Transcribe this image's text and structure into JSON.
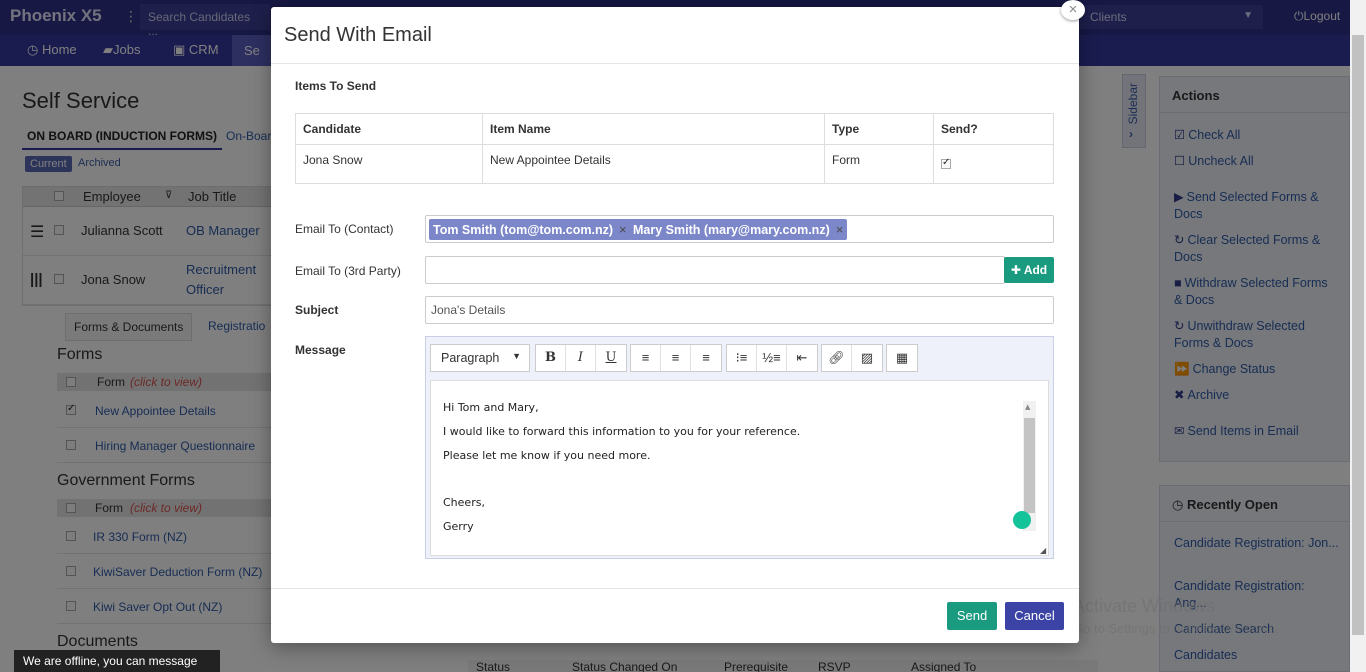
{
  "app": {
    "brand": "Phoenix X5",
    "search_placeholder": "Search Candidates ...",
    "clients_label": "Clients",
    "logout_label": "Logout"
  },
  "nav": {
    "items": [
      "Home",
      "Jobs",
      "CRM",
      "Se"
    ]
  },
  "page": {
    "title": "Self Service",
    "tab_onboard": "ON BOARD (INDUCTION FORMS)",
    "tab_onboard2": "On-Boar",
    "pill_current": "Current",
    "pill_archived": "Archived",
    "table_headers": {
      "employee": "Employee",
      "job_title": "Job Title"
    },
    "rows": [
      {
        "employee": "Julianna Scott",
        "job_title": "OB Manager"
      },
      {
        "employee": "Jona Snow",
        "job_title_1": "Recruitment",
        "job_title_2": "Officer"
      }
    ],
    "subtab_forms": "Forms & Documents",
    "subtab_reg": "Registratio",
    "forms_title": "Forms",
    "form_col": "Form",
    "form_col_hint": "(click to view)",
    "forms": [
      "New Appointee Details",
      "Hiring Manager Questionnaire"
    ],
    "gov_title": "Government Forms",
    "gov_forms": [
      "IR 330 Form (NZ)",
      "KiwiSaver Deduction Form (NZ)",
      "Kiwi Saver Opt Out (NZ)"
    ],
    "documents_title": "Documents",
    "doc_headers": [
      "Status",
      "Status Changed On",
      "Prerequisite",
      "RSVP",
      "Assigned To"
    ]
  },
  "sidebar": {
    "toggle_label": "Sidebar",
    "actions_title": "Actions",
    "actions": [
      "Check All",
      "Uncheck All",
      "Send Selected Forms & Docs",
      "Clear Selected Forms & Docs",
      "Withdraw Selected Forms & Docs",
      "Unwithdraw Selected Forms & Docs",
      "Change Status",
      "Archive",
      "Send Items in Email"
    ],
    "recent_title": "Recently Open",
    "recent": [
      "Candidate Registration: Jon...",
      "Candidate Registration: Ang...",
      "Candidate Search",
      "Candidates"
    ]
  },
  "offline_message": "We are offline, you can message us.",
  "watermark": {
    "line1": "Activate Windows",
    "line2": "Go to Settings to activate Windows."
  },
  "modal": {
    "title": "Send With Email",
    "items_title": "Items To Send",
    "table_headers": [
      "Candidate",
      "Item Name",
      "Type",
      "Send?"
    ],
    "table_rows": [
      {
        "candidate": "Jona Snow",
        "item": "New Appointee Details",
        "type": "Form",
        "send": true
      }
    ],
    "email_to_label": "Email To (Contact)",
    "email_tags": [
      "Tom Smith (tom@tom.com.nz)",
      "Mary Smith (mary@mary.com.nz)"
    ],
    "email_3rd_label": "Email To (3rd Party)",
    "add_label": "Add",
    "subject_label": "Subject",
    "subject_value": "Jona's Details",
    "message_label": "Message",
    "paragraph_label": "Paragraph",
    "message_lines": [
      "Hi Tom and Mary,",
      "I would like to forward this information to you for your reference.",
      "Please let me know if you need more.",
      "",
      "Cheers,",
      "Gerry"
    ],
    "send_label": "Send",
    "cancel_label": "Cancel"
  }
}
